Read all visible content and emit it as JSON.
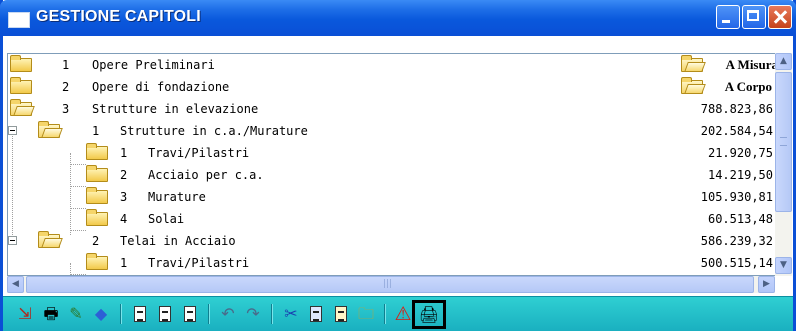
{
  "window": {
    "title": "GESTIONE CAPITOLI"
  },
  "tree": {
    "rows": [
      {
        "num": "1",
        "label": "Opere Preliminari",
        "value": "",
        "tag": "A Misura"
      },
      {
        "num": "2",
        "label": "Opere di fondazione",
        "value": "",
        "tag": "A Corpo"
      },
      {
        "num": "3",
        "label": "Strutture in elevazione",
        "value": "788.823,86",
        "tag": ""
      },
      {
        "num": "1",
        "label": "Strutture in c.a./Murature",
        "value": "202.584,54",
        "tag": ""
      },
      {
        "num": "1",
        "label": "Travi/Pilastri",
        "value": "21.920,75",
        "tag": ""
      },
      {
        "num": "2",
        "label": "Acciaio per c.a.",
        "value": "14.219,50",
        "tag": ""
      },
      {
        "num": "3",
        "label": "Murature",
        "value": "105.930,81",
        "tag": ""
      },
      {
        "num": "4",
        "label": "Solai",
        "value": "60.513,48",
        "tag": ""
      },
      {
        "num": "2",
        "label": "Telai in Acciaio",
        "value": "586.239,32",
        "tag": ""
      },
      {
        "num": "1",
        "label": "Travi/Pilastri",
        "value": "500.515,14",
        "tag": ""
      }
    ]
  },
  "scroll": {
    "h_thumb_glyph": "III"
  },
  "toolbar": {
    "icons": [
      "export-icon",
      "print-icon",
      "edit-icon",
      "eraser-icon",
      "doc-icon",
      "doc-icon",
      "doc-icon",
      "undo-icon",
      "redo-icon",
      "cut-icon",
      "copy-icon",
      "paste-icon",
      "folder-icon",
      "warning-icon",
      "printer-icon"
    ]
  },
  "colors": {
    "titlebar": "#0a4fd6",
    "toolbar": "#1fbfcc",
    "selection_border": "#000000"
  }
}
